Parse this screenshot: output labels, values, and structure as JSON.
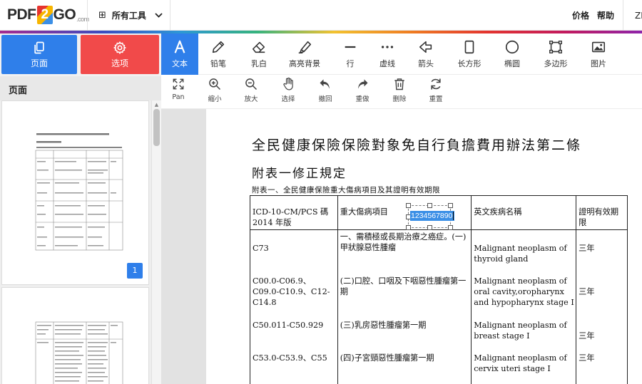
{
  "header": {
    "logo_left": "PDF",
    "logo_mid": "2",
    "logo_right": "GO",
    "logo_suffix": ".com",
    "all_tools": "所有工具",
    "nav": [
      {
        "label": "价格"
      },
      {
        "label": "帮助"
      },
      {
        "label": "ZH"
      }
    ]
  },
  "left_panel": {
    "pages_button": "页面",
    "options_button": "选项",
    "pages_heading": "页面",
    "page_number": "1"
  },
  "toolbar": {
    "tools": [
      {
        "label": "文本",
        "icon": "text-icon",
        "active": true
      },
      {
        "label": "铅笔",
        "icon": "pencil-icon"
      },
      {
        "label": "乳白",
        "icon": "eraser-icon"
      },
      {
        "label": "高亮背景",
        "icon": "highlighter-icon"
      },
      {
        "label": "行",
        "icon": "line-icon"
      },
      {
        "label": "虚线",
        "icon": "dotted-line-icon"
      },
      {
        "label": "箭头",
        "icon": "arrow-icon"
      },
      {
        "label": "长方形",
        "icon": "rectangle-icon"
      },
      {
        "label": "椭圆",
        "icon": "ellipse-icon"
      },
      {
        "label": "多边形",
        "icon": "polygon-icon"
      },
      {
        "label": "图片",
        "icon": "image-icon"
      }
    ],
    "actions": [
      {
        "label": "Pan",
        "icon": "pan-icon"
      },
      {
        "label": "缩小",
        "icon": "zoom-out-icon"
      },
      {
        "label": "放大",
        "icon": "zoom-in-icon"
      },
      {
        "label": "选择",
        "icon": "select-hand-icon"
      },
      {
        "label": "撤回",
        "icon": "undo-icon"
      },
      {
        "label": "重做",
        "icon": "redo-icon"
      },
      {
        "label": "删除",
        "icon": "trash-icon"
      },
      {
        "label": "重置",
        "icon": "reset-icon"
      }
    ]
  },
  "document": {
    "title": "全民健康保險保險對象免自行負擔費用辦法第二條",
    "subtitle": "附表一修正規定",
    "caption": "附表一、全民健康保險重大傷病項目及其證明有效期限",
    "text_box_value": "1234567890",
    "table": {
      "headers": [
        "ICD-10-CM/PCS 碼 2014 年版",
        "重大傷病項目",
        "英文疾病名稱",
        "證明有效期限"
      ],
      "rows": [
        {
          "code": "C73",
          "item": "一、需積極或長期治療之癌症。(一)甲狀腺惡性腫瘤",
          "english": "Malignant neoplasm of thyroid gland",
          "period": "三年"
        },
        {
          "code": "C00.0-C06.9、C09.0-C10.9、C12-C14.8",
          "item": "(二)口腔、口咽及下咽惡性腫瘤第一期",
          "english": "Malignant neoplasm of oral cavity,oropharynx and hypopharynx stage I",
          "period": "三年"
        },
        {
          "code": "C50.011-C50.929",
          "item": "(三)乳房惡性腫瘤第一期",
          "english": "Malignant neoplasm of breast stage I",
          "period": "三年"
        },
        {
          "code": "C53.0-C53.9、C55",
          "item": "(四)子宮頸惡性腫瘤第一期",
          "english": "Malignant neoplasm of cervix uteri stage I",
          "period": "三年"
        }
      ]
    }
  },
  "colors": {
    "primary_blue": "#2f7fea",
    "options_red": "#f14a4a",
    "selection_blue": "#3b8fe6"
  }
}
